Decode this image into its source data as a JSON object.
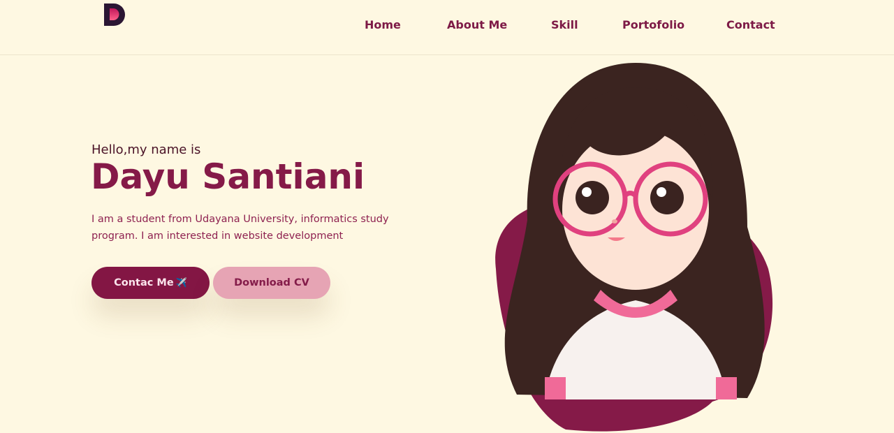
{
  "header": {
    "logo_letter": "D",
    "nav": [
      {
        "label": "Home"
      },
      {
        "label": "About Me"
      },
      {
        "label": "Skill"
      },
      {
        "label": "Portofolio"
      },
      {
        "label": "Contact"
      }
    ]
  },
  "hero": {
    "greeting": "Hello,my name is",
    "name": "Dayu Santiani",
    "description": "I am a student from Udayana University, informatics study program. I am interested in website development",
    "contact_button": "Contac Me",
    "contact_icon": "✈️",
    "download_button": "Download CV"
  },
  "colors": {
    "background": "#fef8e2",
    "primary": "#831644",
    "secondary": "#e6a4b4"
  }
}
